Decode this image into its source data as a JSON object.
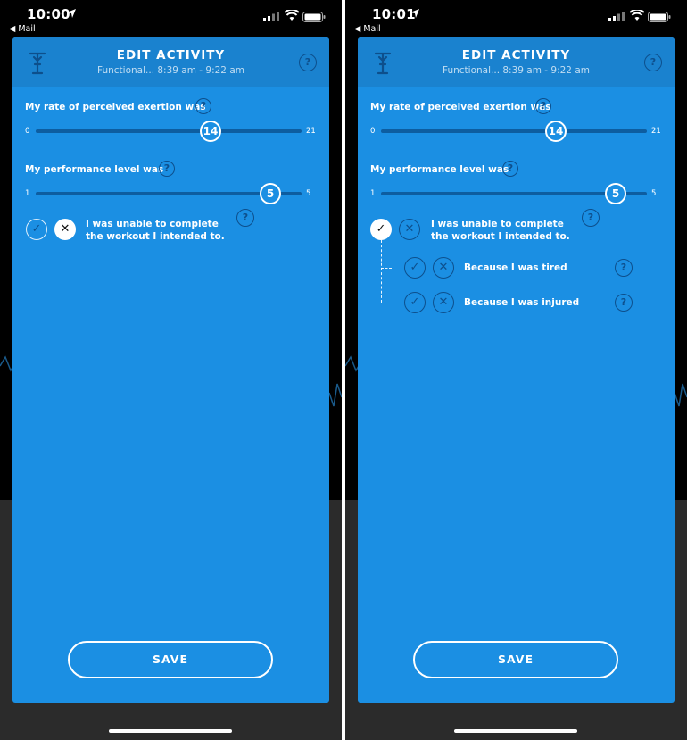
{
  "screens": [
    {
      "status": {
        "time": "10:00",
        "back_app": "Mail"
      },
      "header": {
        "title": "EDIT ACTIVITY",
        "subtitle": "Functional... 8:39 am - 9:22 am"
      },
      "exertion": {
        "label": "My rate of perceived exertion was",
        "min": "0",
        "max": "21",
        "value": "14",
        "value_num": 14
      },
      "performance": {
        "label": "My performance level was",
        "min": "1",
        "max": "5",
        "value": "5",
        "value_num": 5
      },
      "unable": {
        "line1": "I was unable to complete",
        "line2": "the workout I intended to.",
        "state": "no"
      },
      "save_label": "SAVE"
    },
    {
      "status": {
        "time": "10:01",
        "back_app": "Mail"
      },
      "header": {
        "title": "EDIT ACTIVITY",
        "subtitle": "Functional... 8:39 am - 9:22 am"
      },
      "exertion": {
        "label": "My rate of perceived exertion was",
        "min": "0",
        "max": "21",
        "value": "14",
        "value_num": 14
      },
      "performance": {
        "label": "My performance level was",
        "min": "1",
        "max": "5",
        "value": "5",
        "value_num": 5
      },
      "unable": {
        "line1": "I was unable to complete",
        "line2": "the workout I intended to.",
        "state": "yes"
      },
      "reasons": [
        {
          "label": "Because I was tired"
        },
        {
          "label": "Because I was injured"
        }
      ],
      "save_label": "SAVE"
    }
  ],
  "icons": {
    "check": "✓",
    "cross": "✕",
    "help": "?",
    "back": "◀"
  },
  "colors": {
    "sheet": "#1b8fe3",
    "header": "#1a82cf",
    "accent_dark": "#0d4f8c"
  }
}
